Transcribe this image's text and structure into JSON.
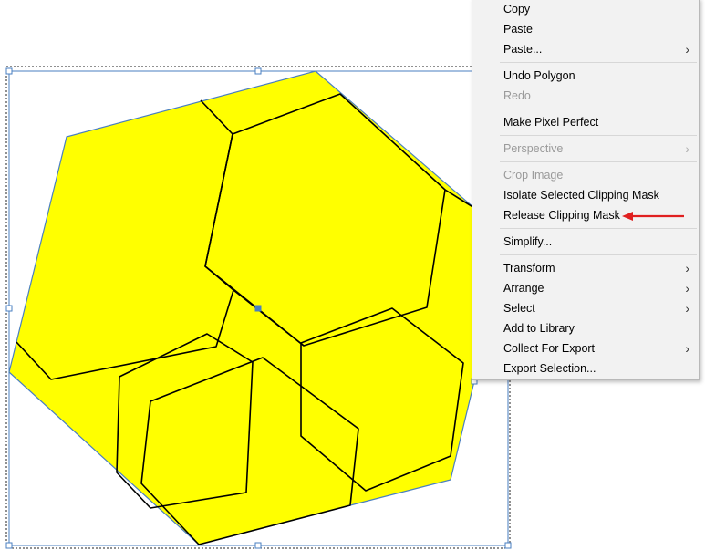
{
  "context_menu": {
    "items": [
      {
        "label": "Copy",
        "enabled": true,
        "submenu": false
      },
      {
        "label": "Paste",
        "enabled": true,
        "submenu": false
      },
      {
        "label": "Paste...",
        "enabled": true,
        "submenu": true
      },
      {
        "label": "Undo Polygon",
        "enabled": true,
        "submenu": false
      },
      {
        "label": "Redo",
        "enabled": false,
        "submenu": false
      },
      {
        "label": "Make Pixel Perfect",
        "enabled": true,
        "submenu": false
      },
      {
        "label": "Perspective",
        "enabled": false,
        "submenu": true
      },
      {
        "label": "Crop Image",
        "enabled": false,
        "submenu": false
      },
      {
        "label": "Isolate Selected Clipping Mask",
        "enabled": true,
        "submenu": false
      },
      {
        "label": "Release Clipping Mask",
        "enabled": true,
        "submenu": false,
        "highlighted_by_annotation": true
      },
      {
        "label": "Simplify...",
        "enabled": true,
        "submenu": false
      },
      {
        "label": "Transform",
        "enabled": true,
        "submenu": true
      },
      {
        "label": "Arrange",
        "enabled": true,
        "submenu": true
      },
      {
        "label": "Select",
        "enabled": true,
        "submenu": true
      },
      {
        "label": "Add to Library",
        "enabled": true,
        "submenu": false
      },
      {
        "label": "Collect For Export",
        "enabled": true,
        "submenu": true
      },
      {
        "label": "Export Selection...",
        "enabled": true,
        "submenu": false
      }
    ],
    "submenu_glyph": "›"
  },
  "canvas": {
    "fill_color": "#ffff00",
    "stroke_color": "#000000",
    "selection_color": "#4a7fc1",
    "annotation_color": "#e02020"
  }
}
